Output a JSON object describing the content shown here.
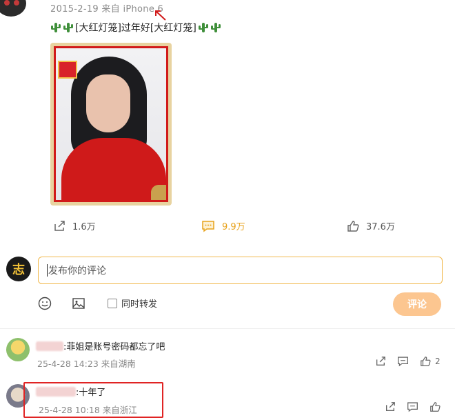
{
  "post": {
    "meta": "2015-2-19 来自 iPhone 6",
    "text_prefix": "[大红灯笼]过年好[大红灯笼]"
  },
  "actions": {
    "share_count": "1.6万",
    "comment_count": "9.9万",
    "like_count": "37.6万"
  },
  "composer": {
    "placeholder": "发布你的评论",
    "avatar_char": "志",
    "repost_label": "同时转发",
    "submit_label": "评论"
  },
  "comments": [
    {
      "text": ":菲姐是账号密码都忘了吧",
      "meta": "25-4-28 14:23 来自湖南",
      "like_count": "2"
    },
    {
      "text": ":十年了",
      "meta": "25-4-28 10:18 来自浙江",
      "like_count": ""
    }
  ],
  "colors": {
    "accent": "#e7a21b",
    "highlight": "#e02424",
    "input_border": "#f1b84b",
    "submit_bg": "#fcc690"
  },
  "icons": [
    "share-icon",
    "comment-icon",
    "like-icon",
    "emoji-icon",
    "image-icon",
    "cactus-icon"
  ]
}
